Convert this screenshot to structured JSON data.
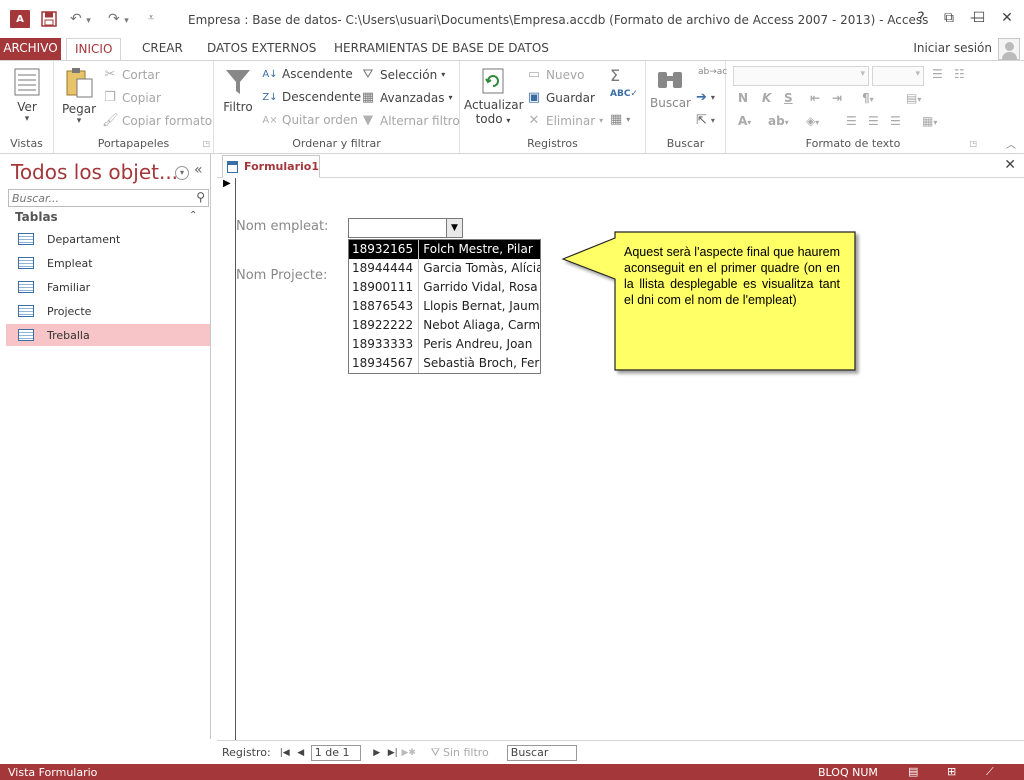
{
  "titlebar": {
    "title": "Empresa : Base de datos- C:\\Users\\usuari\\Documents\\Empresa.accdb (Formato de archivo de Access 2007 - 2013) - Access",
    "logo_text": "A",
    "help": "?",
    "restore_ribbon": "⧉",
    "minimize": "—",
    "maximize": "☐",
    "close": "✕"
  },
  "tabs": {
    "file": "ARCHIVO",
    "home": "INICIO",
    "create": "CREAR",
    "external": "DATOS EXTERNOS",
    "tools": "HERRAMIENTAS DE BASE DE DATOS",
    "signin": "Iniciar sesión"
  },
  "ribbon": {
    "views": {
      "label": "Vistas",
      "view_button": "Ver"
    },
    "clipboard": {
      "label": "Portapapeles",
      "paste": "Pegar",
      "cut": "Cortar",
      "copy": "Copiar",
      "format_painter": "Copiar formato"
    },
    "sort_filter": {
      "label": "Ordenar y filtrar",
      "filter": "Filtro",
      "ascending": "Ascendente",
      "descending": "Descendente",
      "remove_sort": "Quitar orden",
      "selection": "Selección",
      "advanced": "Avanzadas",
      "toggle_filter": "Alternar filtro"
    },
    "records": {
      "label": "Registros",
      "refresh_line1": "Actualizar",
      "refresh_line2": "todo",
      "new": "Nuevo",
      "save": "Guardar",
      "delete": "Eliminar"
    },
    "find": {
      "label": "Buscar",
      "find_button": "Buscar"
    },
    "text_format": {
      "label": "Formato de texto",
      "bold": "N",
      "italic": "K",
      "underline": "S"
    }
  },
  "nav": {
    "title": "Todos los objet...",
    "search_placeholder": "Buscar...",
    "section": "Tablas",
    "items": [
      "Departament",
      "Empleat",
      "Familiar",
      "Projecte",
      "Treballa"
    ]
  },
  "document": {
    "tab_label": "Formulario1",
    "label_employee": "Nom empleat:",
    "label_project": "Nom Projecte:",
    "dropdown_rows": [
      {
        "dni": "18932165",
        "name": "Folch Mestre, Pilar"
      },
      {
        "dni": "18944444",
        "name": "Garcia Tomàs, Alícia"
      },
      {
        "dni": "18900111",
        "name": "Garrido Vidal, Rosa"
      },
      {
        "dni": "18876543",
        "name": "Llopis Bernat, Jaume"
      },
      {
        "dni": "18922222",
        "name": "Nebot Aliaga, Carme"
      },
      {
        "dni": "18933333",
        "name": "Peris Andreu, Joan"
      },
      {
        "dni": "18934567",
        "name": "Sebastià Broch, Ferran"
      }
    ],
    "callout": "Aquest serà l'aspecte final que haurem aconseguit en el primer quadre (on en la llista desplegable es visualitza tant el dni com el nom de l'empleat)"
  },
  "record_nav": {
    "label": "Registro:",
    "position": "1 de 1",
    "filter": "Sin filtro",
    "search": "Buscar"
  },
  "status": {
    "view": "Vista Formulario",
    "numlock": "BLOQ NUM"
  },
  "colors": {
    "accent": "#a4373a",
    "selection": "#f7c5c7",
    "callout_fill": "#ffff66"
  }
}
